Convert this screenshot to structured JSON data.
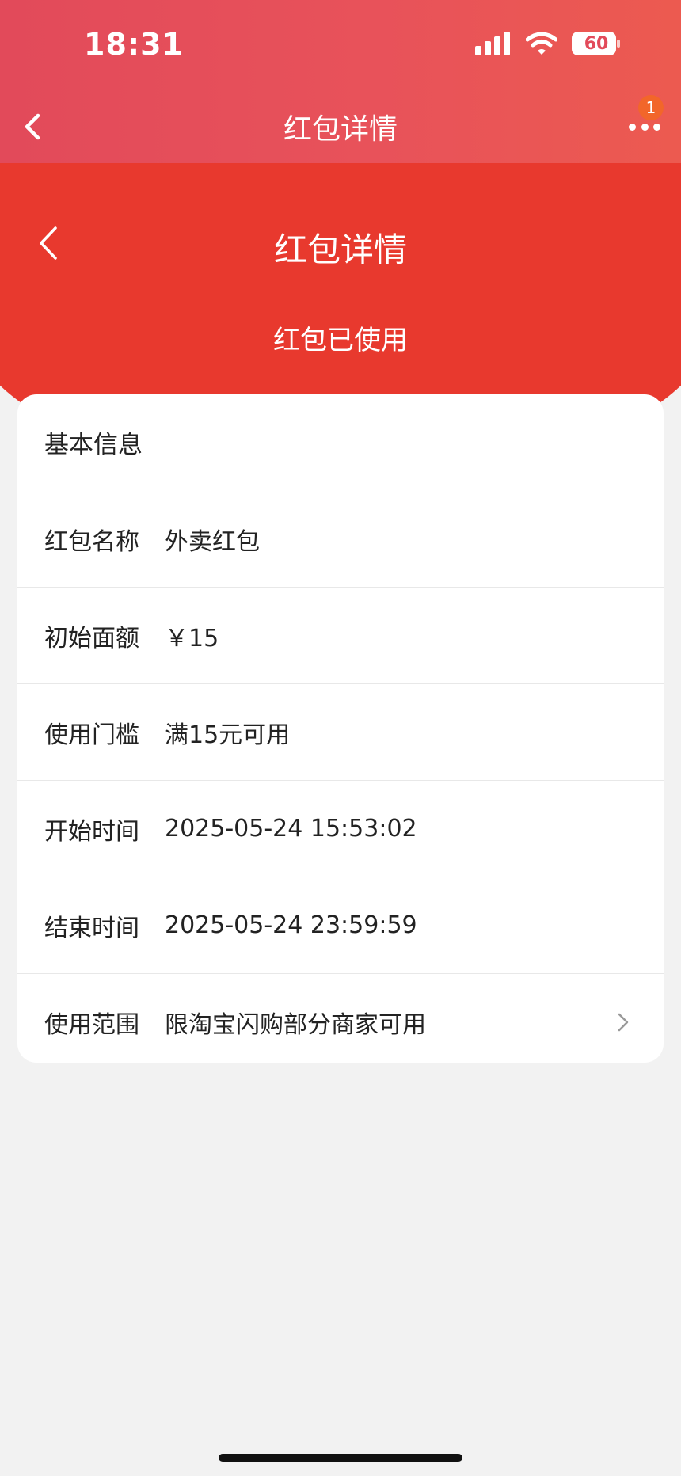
{
  "status_bar": {
    "time": "18:31",
    "battery": "60"
  },
  "mini_nav": {
    "title": "红包详情",
    "badge": "1"
  },
  "header": {
    "title": "红包详情",
    "status": "红包已使用"
  },
  "card": {
    "title": "基本信息",
    "rows": [
      {
        "label": "红包名称",
        "value": "外卖红包"
      },
      {
        "label": "初始面额",
        "value": "￥15"
      },
      {
        "label": "使用门槛",
        "value": "满15元可用"
      },
      {
        "label": "开始时间",
        "value": "2025-05-24 15:53:02"
      },
      {
        "label": "结束时间",
        "value": "2025-05-24 23:59:59"
      },
      {
        "label": "使用范围",
        "value": "限淘宝闪购部分商家可用"
      }
    ]
  },
  "colors": {
    "header_red": "#e8392e",
    "nav_pink": "#e24a5a",
    "badge_orange": "#f2662a"
  },
  "icons": [
    "signal-icon",
    "wifi-icon",
    "battery-icon",
    "back-arrow-icon",
    "more-dots-icon",
    "chevron-right-icon"
  ]
}
